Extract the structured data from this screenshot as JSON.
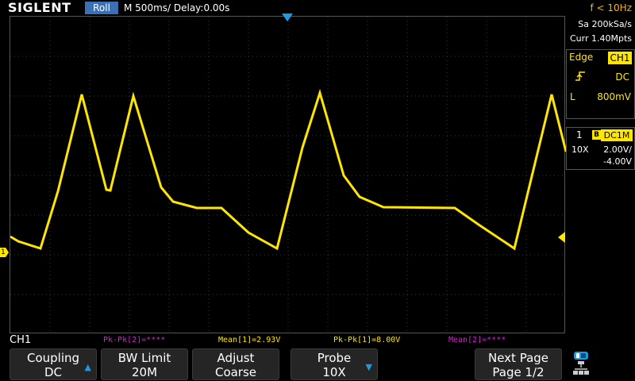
{
  "header": {
    "logo": "SIGLENT",
    "mode": "Roll",
    "timebase": "M 500ms/  Delay:0.00s",
    "trigger_frequency": "f < 10Hz"
  },
  "acquisition": {
    "sample_rate": "Sa 200kSa/s",
    "memory_depth": "Curr 1.40Mpts"
  },
  "trigger": {
    "type": "Edge",
    "source": "CH1",
    "slope_icon": "rising-edge-icon",
    "coupling": "DC",
    "level_label": "L",
    "level": "800mV"
  },
  "channel": {
    "number": "1",
    "bw_badge": "B",
    "coupling": "DC1M",
    "probe": "10X",
    "volts_per_div": "2.00V/",
    "offset": "-4.00V",
    "marker_label": "1"
  },
  "measurements": {
    "channel": "CH1",
    "items": [
      {
        "text": "Pk-Pk[2]=****",
        "color": "#d020d0"
      },
      {
        "text": "Mean[1]=2.93V",
        "color": "#ffe600"
      },
      {
        "text": "Pk-Pk[1]=8.00V",
        "color": "#ffe600"
      },
      {
        "text": "Mean[2]=****",
        "color": "#d020d0"
      }
    ]
  },
  "softkeys": [
    {
      "line1": "Coupling",
      "line2": "DC",
      "arrow": "▲"
    },
    {
      "line1": "BW Limit",
      "line2": "20M",
      "arrow": ""
    },
    {
      "line1": "Adjust",
      "line2": "Coarse",
      "arrow": ""
    },
    {
      "line1": "Probe",
      "line2": "10X",
      "arrow": "▼"
    },
    {
      "line1": "Next Page",
      "line2": "Page 1/2",
      "arrow": ""
    }
  ],
  "colors": {
    "ch1_trace": "#ffe600",
    "accent_blue": "#1e9be0",
    "badge_blue": "#3b6fb6",
    "trigger_freq": "#ffb200",
    "measurement_magenta": "#d020d0"
  }
}
